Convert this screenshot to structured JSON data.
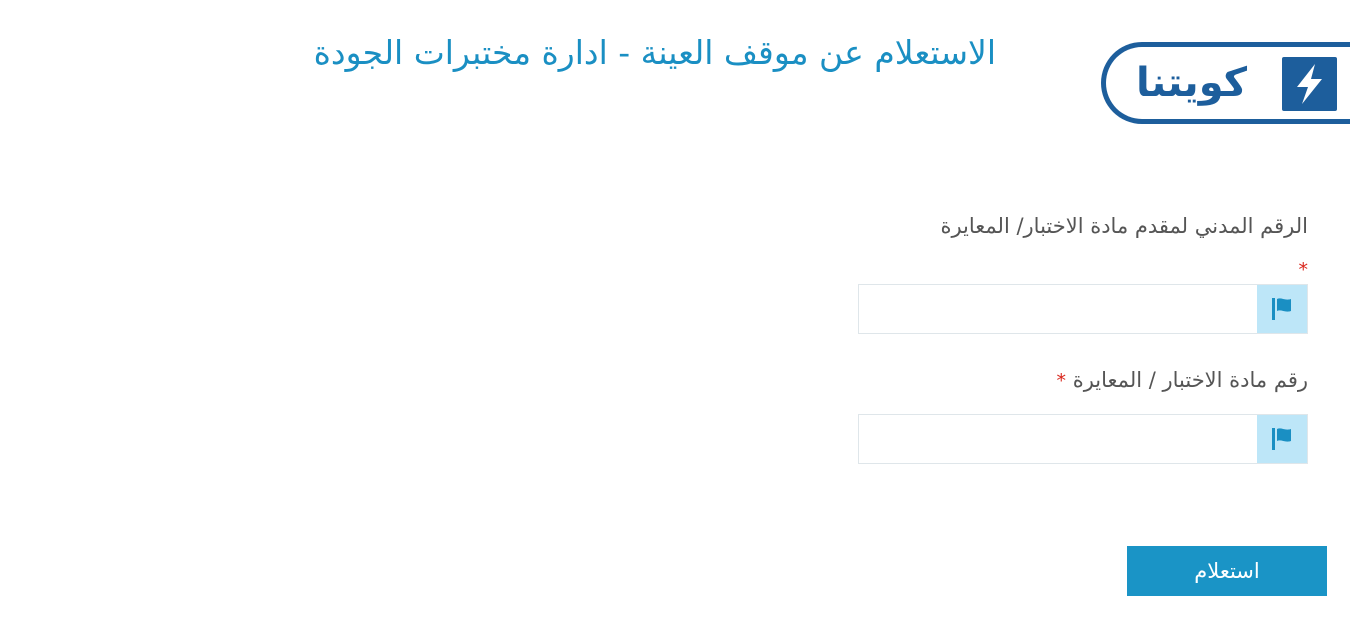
{
  "brand": {
    "logo_text": "كويتنا",
    "logo_color": "#1d5e9c",
    "logo_icon": "lightning-bolt-icon"
  },
  "header": {
    "title": "الاستعلام عن موقف العينة - ادارة مختبرات الجودة",
    "title_color": "#1a8fc3"
  },
  "form": {
    "civil_id": {
      "label": "الرقم المدني لمقدم مادة الاختبار/ المعايرة",
      "required_mark": "*",
      "value": "",
      "placeholder": "",
      "icon": "flag-icon"
    },
    "test_number": {
      "label": "رقم مادة الاختبار / المعايرة",
      "required_mark": "*",
      "value": "",
      "placeholder": "",
      "icon": "flag-icon"
    },
    "submit_label": "استعلام"
  },
  "colors": {
    "accent": "#1a94c6",
    "addon_background": "#bde6f8",
    "required": "#d9261c"
  }
}
